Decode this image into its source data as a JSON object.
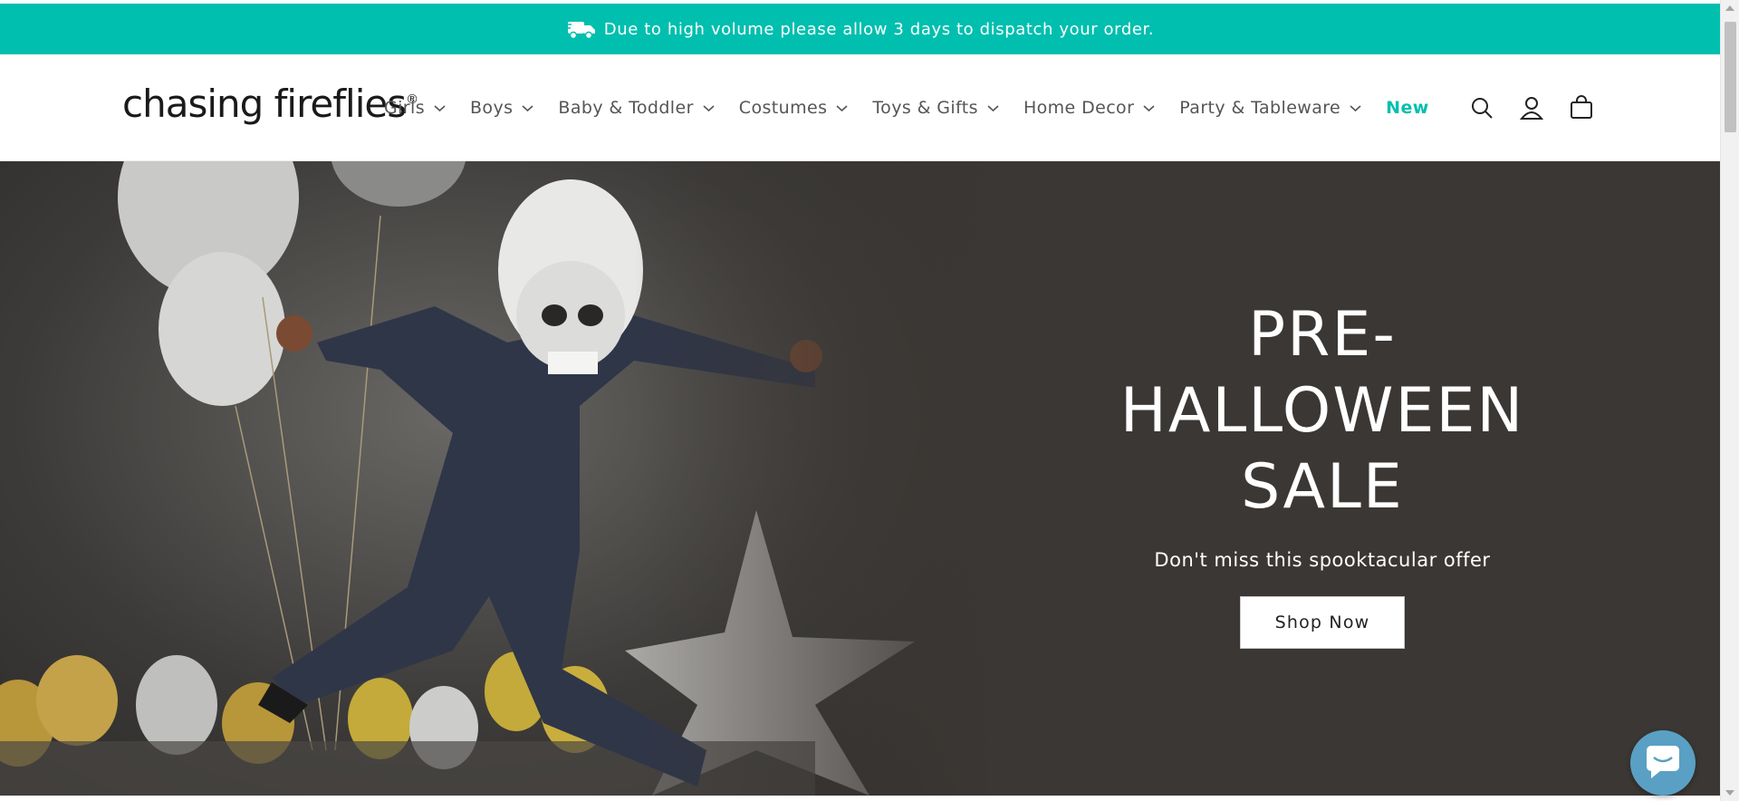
{
  "announcement": {
    "text": "Due to high volume please allow 3 days to dispatch your order.",
    "icon": "delivery-truck-icon"
  },
  "header": {
    "logo_text": "chasing fireflies",
    "logo_mark": "®",
    "nav": [
      {
        "label": "Girls",
        "has_dropdown": true
      },
      {
        "label": "Boys",
        "has_dropdown": true
      },
      {
        "label": "Baby & Toddler",
        "has_dropdown": true
      },
      {
        "label": "Costumes",
        "has_dropdown": true
      },
      {
        "label": "Toys & Gifts",
        "has_dropdown": true
      },
      {
        "label": "Home Decor",
        "has_dropdown": true
      },
      {
        "label": "Party & Tableware",
        "has_dropdown": true
      },
      {
        "label": "New",
        "has_dropdown": false
      }
    ],
    "icons": [
      "search-icon",
      "account-icon",
      "cart-icon"
    ]
  },
  "hero": {
    "title": "PRE-\nHALLOWEEN\nSALE",
    "subtitle": "Don't miss this spooktacular offer",
    "button_label": "Shop Now"
  },
  "colors": {
    "accent": "#00bfae",
    "hero_bg": "#3b3734",
    "chat": "#5aa0c4"
  }
}
